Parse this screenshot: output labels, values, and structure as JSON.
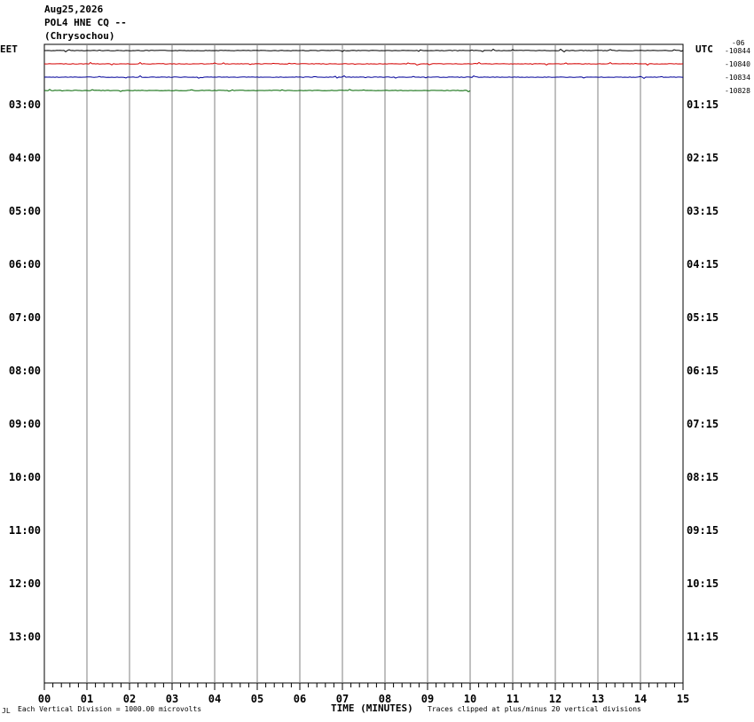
{
  "header": {
    "date": "Aug25,2026",
    "station": "POL4 HNE CQ --",
    "location": "(Chrysochou)"
  },
  "left_tz": "EET",
  "right_tz": "UTC",
  "top_right_label": "-06",
  "footer": {
    "scale_note": "Each Vertical Division = 1000.00 microvolts",
    "axis_title": "TIME (MINUTES)",
    "clip_note": "Traces clipped at plus/minus 20 vertical divisions",
    "corner_mark": "JL"
  },
  "chart_data": {
    "type": "line",
    "title": "POL4 HNE CQ -- (Chrysochou)",
    "xlabel": "TIME (MINUTES)",
    "xlim": [
      0,
      15
    ],
    "x_ticks": [
      "00",
      "01",
      "02",
      "03",
      "04",
      "05",
      "06",
      "07",
      "08",
      "09",
      "10",
      "11",
      "12",
      "13",
      "14",
      "15"
    ],
    "left_row_labels": [
      "03:00",
      "04:00",
      "05:00",
      "06:00",
      "07:00",
      "08:00",
      "09:00",
      "10:00",
      "11:00",
      "12:00",
      "13:00"
    ],
    "right_row_labels": [
      "01:15",
      "02:15",
      "03:15",
      "04:15",
      "05:15",
      "06:15",
      "07:15",
      "08:15",
      "09:15",
      "10:15",
      "11:15"
    ],
    "series": [
      {
        "name": "-10844",
        "color": "#000000",
        "end_minute": 15
      },
      {
        "name": "-10840",
        "color": "#d40000",
        "end_minute": 15
      },
      {
        "name": "-10834",
        "color": "#000099",
        "end_minute": 15
      },
      {
        "name": "-10828",
        "color": "#006600",
        "end_minute": 10
      }
    ],
    "grid": true
  }
}
